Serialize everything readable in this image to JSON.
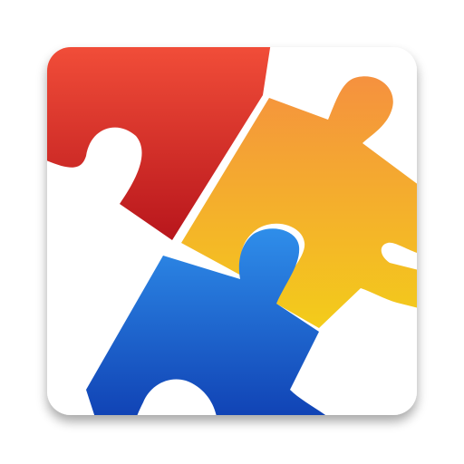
{
  "icon": {
    "semantic": "jigsaw-puzzle-pieces-app-icon",
    "background_color": "#ffffff",
    "pieces": [
      {
        "name": "red-puzzle-piece",
        "color_light": "#f4503a",
        "color_dark": "#b8161c"
      },
      {
        "name": "orange-yellow-puzzle-piece",
        "color_light": "#f5913f",
        "color_dark": "#f3cc1a"
      },
      {
        "name": "blue-puzzle-piece",
        "color_light": "#2f8eea",
        "color_dark": "#0f3fb2"
      }
    ]
  }
}
